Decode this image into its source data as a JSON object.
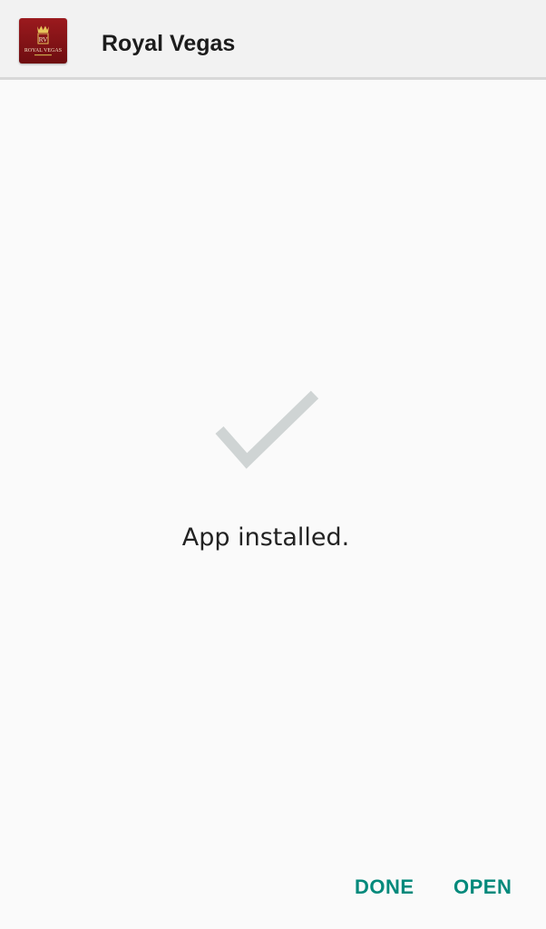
{
  "header": {
    "app_icon": "royal-vegas-logo-icon",
    "app_icon_text": "ROYAL VEGAS",
    "app_icon_monogram": "RV",
    "app_name": "Royal Vegas"
  },
  "main": {
    "status_icon": "checkmark-icon",
    "status_text": "App installed."
  },
  "actions": {
    "done_label": "DONE",
    "open_label": "OPEN"
  },
  "colors": {
    "header_background": "#f2f2f2",
    "page_background": "#fafafa",
    "accent": "#00897b",
    "checkmark": "#cfd4d4",
    "app_icon_background": "#8b1418"
  }
}
